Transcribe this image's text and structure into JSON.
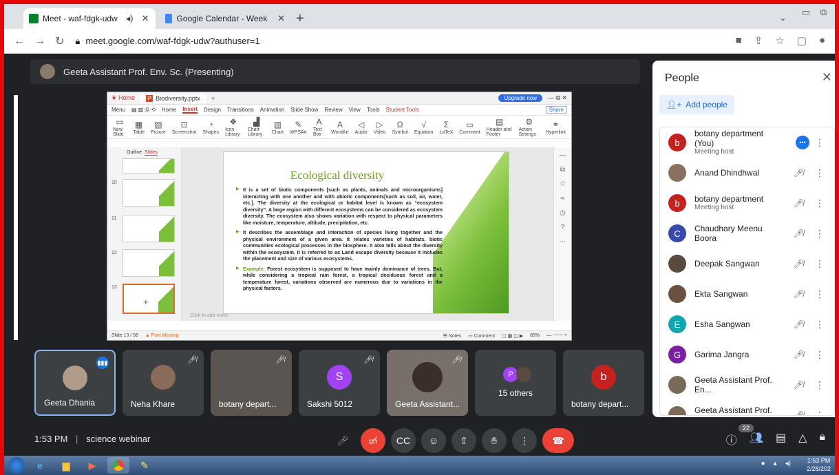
{
  "browser": {
    "tabs": [
      {
        "title": "Meet - waf-fdgk-udw",
        "active": true
      },
      {
        "title": "Google Calendar - Week of Febru",
        "active": false
      }
    ],
    "url": "meet.google.com/waf-fdgk-udw?authuser=1"
  },
  "presenter": {
    "label": "Geeta Assistant Prof. Env. Sc. (Presenting)"
  },
  "presentation": {
    "app_tab_home": "Home",
    "file_tab": "Biodiversity.pptx",
    "upgrade": "Upgrade now",
    "share": "Share",
    "menu": [
      "Menu",
      "Home",
      "Insert",
      "Design",
      "Transitions",
      "Animation",
      "Slide Show",
      "Review",
      "View",
      "Tools",
      "Student Tools"
    ],
    "ribbon": [
      "New Slide",
      "Table",
      "Picture",
      "Screenshot",
      "Shapes",
      "Icon Library",
      "Chart Library",
      "Chart",
      "WPSArt",
      "Text Box",
      "WordArt",
      "Audio",
      "Video",
      "Symbol",
      "Equation",
      "LaTeX",
      "Comment",
      "Header and Footer",
      "Action Settings",
      "Hyperlink"
    ],
    "thumb_tabs": [
      "Outline",
      "Slides"
    ],
    "thumb_numbers": [
      "10",
      "11",
      "12",
      "13"
    ],
    "slide_title": "Ecological diversity",
    "bullets": [
      "It is a set of biotic components [such as plants, animals and microorganisms] interacting with one another and with abiotic components[such as soil, air, water, etc.]. The diversity at the ecological or habitat level is known as “ecosystem diversity”. A large region with different ecosystems can be considered as ecosystem diversity. The ecosystem also shows variation with respect to physical parameters like moisture, temperature, altitude, precipitation, etc.",
      "It describes the assemblage and interaction of species living together and the physical environment of a given area. It relates varieties of habitats, biotic communities ecological processes in the biosphere. It also tells about the diversity within the ecosystem. It is referred to as Land escape diversity because it includes the placement and size of various ecosystems."
    ],
    "example_label": "Example:",
    "example_text": " Forest ecosystem is supposed to have mainly dominance of trees. But, while considering a tropical rain forest, a tropical deciduous forest and a temperature forest, variations observed are numerous due to variations in the physical factors.",
    "notes_hint": "Click to add notes",
    "status_slide": "Slide 13 / 58",
    "status_font": "Font Missing",
    "status_notes": "Notes",
    "status_comment": "Comment",
    "zoom": "65%"
  },
  "tiles": [
    {
      "name": "Geeta Dhania",
      "speaking": true,
      "avatar_letter": "",
      "color": "#b09a8a"
    },
    {
      "name": "Neha Khare",
      "speaking": false,
      "avatar_letter": "",
      "color": "#8a6a5a"
    },
    {
      "name": "botany depart...",
      "speaking": false,
      "avatar_letter": "",
      "color": "#6a6a6a"
    },
    {
      "name": "Sakshi 5012",
      "speaking": false,
      "avatar_letter": "S",
      "color": "#a142f4"
    },
    {
      "name": "Geeta Assistant...",
      "speaking": false,
      "avatar_letter": "",
      "color": "#7a6a5a"
    },
    {
      "name": "15 others",
      "speaking": false,
      "avatar_letter": "P",
      "color": "#a142f4"
    },
    {
      "name": "botany depart...",
      "speaking": false,
      "avatar_letter": "b",
      "color": "#c5221f"
    }
  ],
  "bottombar": {
    "time": "1:53 PM",
    "separator": "|",
    "meeting": "science webinar",
    "participant_count": "22"
  },
  "people_panel": {
    "title": "People",
    "add_people": "Add people",
    "participants": [
      {
        "name": "botany department (You)",
        "role": "Meeting host",
        "letter": "b",
        "color": "#c5221f",
        "speaking": true
      },
      {
        "name": "Anand Dhindhwal",
        "role": "",
        "letter": "",
        "color": "#8a7060",
        "speaking": false
      },
      {
        "name": "botany department",
        "role": "Meeting host",
        "letter": "b",
        "color": "#c5221f",
        "speaking": false
      },
      {
        "name": "Chaudhary Meenu Boora",
        "role": "",
        "letter": "C",
        "color": "#3949ab",
        "speaking": false
      },
      {
        "name": "Deepak Sangwan",
        "role": "",
        "letter": "",
        "color": "#5a4a40",
        "speaking": false
      },
      {
        "name": "Ekta Sangwan",
        "role": "",
        "letter": "",
        "color": "#6a5040",
        "speaking": false
      },
      {
        "name": "Esha Sangwan",
        "role": "",
        "letter": "E",
        "color": "#12a4af",
        "speaking": false
      },
      {
        "name": "Garima Jangra",
        "role": "",
        "letter": "G",
        "color": "#7b1fa2",
        "speaking": false
      },
      {
        "name": "Geeta Assistant Prof. En...",
        "role": "",
        "letter": "",
        "color": "#7a6a5a",
        "speaking": false
      },
      {
        "name": "Geeta Assistant Prof. En...",
        "role": "",
        "letter": "",
        "color": "#7a6a5a",
        "speaking": false
      }
    ]
  },
  "taskbar": {
    "time": "1:53 PM",
    "date": "2/28/202"
  }
}
